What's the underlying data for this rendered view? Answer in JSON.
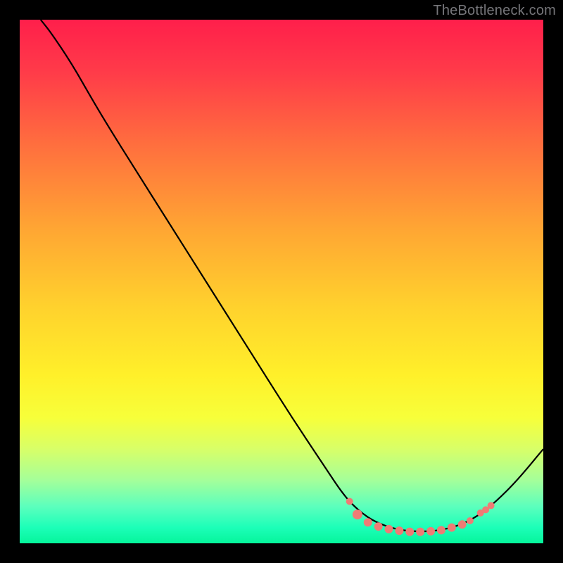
{
  "attribution": "TheBottleneck.com",
  "chart_data": {
    "type": "line",
    "title": "",
    "xlabel": "",
    "ylabel": "",
    "xlim": [
      0,
      100
    ],
    "ylim": [
      0,
      100
    ],
    "grid": false,
    "legend": false,
    "series": [
      {
        "name": "curve",
        "color": "#000000",
        "points": [
          {
            "x": 4.0,
            "y": 100.0
          },
          {
            "x": 6.0,
            "y": 97.5
          },
          {
            "x": 10.0,
            "y": 91.5
          },
          {
            "x": 14.0,
            "y": 84.5
          },
          {
            "x": 17.0,
            "y": 79.5
          },
          {
            "x": 22.0,
            "y": 71.5
          },
          {
            "x": 28.0,
            "y": 62.0
          },
          {
            "x": 34.0,
            "y": 52.5
          },
          {
            "x": 40.0,
            "y": 43.0
          },
          {
            "x": 46.0,
            "y": 33.5
          },
          {
            "x": 52.0,
            "y": 24.0
          },
          {
            "x": 58.0,
            "y": 15.0
          },
          {
            "x": 62.0,
            "y": 9.0
          },
          {
            "x": 65.0,
            "y": 6.0
          },
          {
            "x": 68.0,
            "y": 4.0
          },
          {
            "x": 72.0,
            "y": 2.6
          },
          {
            "x": 76.0,
            "y": 2.2
          },
          {
            "x": 80.0,
            "y": 2.4
          },
          {
            "x": 84.0,
            "y": 3.4
          },
          {
            "x": 87.5,
            "y": 5.2
          },
          {
            "x": 91.0,
            "y": 8.0
          },
          {
            "x": 95.0,
            "y": 12.0
          },
          {
            "x": 100.0,
            "y": 18.0
          }
        ]
      },
      {
        "name": "markers",
        "color": "#ef7b75",
        "points": [
          {
            "x": 63.0,
            "y": 8.0,
            "r": 5
          },
          {
            "x": 64.5,
            "y": 5.5,
            "r": 7
          },
          {
            "x": 66.5,
            "y": 4.0,
            "r": 6
          },
          {
            "x": 68.5,
            "y": 3.2,
            "r": 6
          },
          {
            "x": 70.5,
            "y": 2.7,
            "r": 6
          },
          {
            "x": 72.5,
            "y": 2.4,
            "r": 6
          },
          {
            "x": 74.5,
            "y": 2.2,
            "r": 6
          },
          {
            "x": 76.5,
            "y": 2.2,
            "r": 6
          },
          {
            "x": 78.5,
            "y": 2.3,
            "r": 6
          },
          {
            "x": 80.5,
            "y": 2.5,
            "r": 6
          },
          {
            "x": 82.5,
            "y": 3.0,
            "r": 6
          },
          {
            "x": 84.5,
            "y": 3.6,
            "r": 6
          },
          {
            "x": 86.0,
            "y": 4.3,
            "r": 5
          },
          {
            "x": 88.0,
            "y": 5.8,
            "r": 5
          },
          {
            "x": 89.0,
            "y": 6.4,
            "r": 5
          },
          {
            "x": 90.0,
            "y": 7.2,
            "r": 5
          }
        ]
      }
    ],
    "background": {
      "type": "vertical-gradient",
      "stops": [
        {
          "pos": 0.0,
          "color": "#ff1f4b"
        },
        {
          "pos": 0.4,
          "color": "#ffa633"
        },
        {
          "pos": 0.68,
          "color": "#fff02a"
        },
        {
          "pos": 1.0,
          "color": "#05f59b"
        }
      ]
    }
  }
}
